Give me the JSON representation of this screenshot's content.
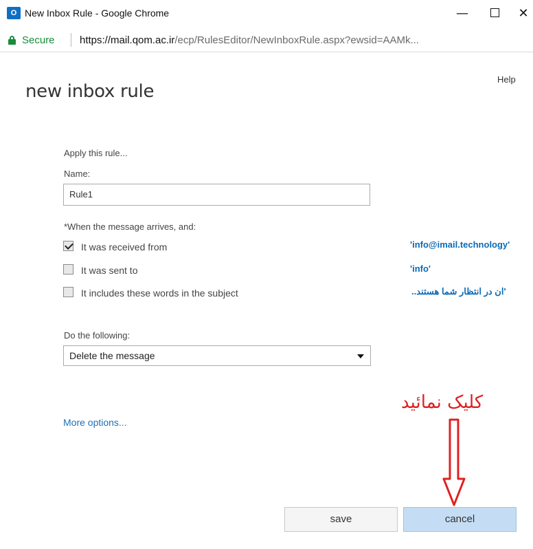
{
  "window": {
    "app_icon_text": "O",
    "title": "New Inbox Rule - Google Chrome",
    "minimize_symbol": "—",
    "close_symbol": "✕"
  },
  "address_bar": {
    "secure_label": "Secure",
    "url_host": "https://mail.qom.ac.ir",
    "url_path": "/ecp/RulesEditor/NewInboxRule.aspx?ewsid=AAMk..."
  },
  "page": {
    "help": "Help",
    "title": "new inbox rule",
    "apply_label": "Apply this rule...",
    "name_label": "Name:",
    "name_value": "Rule1",
    "when_label": "*When the message arrives, and:",
    "conditions": [
      {
        "label": "It was received from",
        "checked": true,
        "value": "'info@imail.technology'"
      },
      {
        "label": "It was sent to",
        "checked": false,
        "value": "'info'"
      },
      {
        "label": "It includes these words in the subject",
        "checked": false,
        "value": "..ان در انتظار شما هستند'"
      }
    ],
    "do_label": "Do the following:",
    "action_selected": "Delete the message",
    "more_options": "More options...",
    "save_label": "save",
    "cancel_label": "cancel"
  },
  "annotation": {
    "text": "کلیک نمائید",
    "color": "#e02020"
  },
  "colors": {
    "accent": "#0a6ab7",
    "secure_green": "#1a8b3c",
    "cancel_bg": "#c5ddf4"
  }
}
